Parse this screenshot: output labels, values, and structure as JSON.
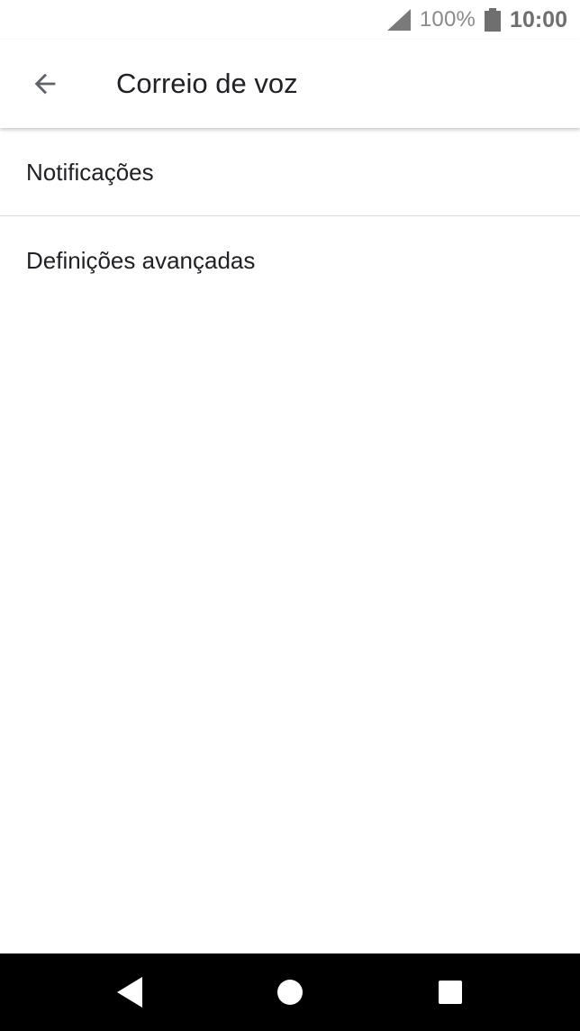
{
  "status_bar": {
    "battery_percent": "100%",
    "time": "10:00",
    "icons": [
      "signal-icon",
      "battery-icon"
    ]
  },
  "app_bar": {
    "title": "Correio de voz",
    "back_icon": "arrow-back-icon"
  },
  "settings": {
    "items": [
      {
        "label": "Notificações"
      },
      {
        "label": "Definições avançadas"
      }
    ]
  },
  "nav_bar": {
    "icons": [
      "nav-back-icon",
      "nav-home-icon",
      "nav-recents-icon"
    ]
  },
  "colors": {
    "background": "#ffffff",
    "text_primary": "#202124",
    "status_text": "#6f6f6f",
    "divider": "#dadada",
    "nav_bar": "#000000"
  }
}
